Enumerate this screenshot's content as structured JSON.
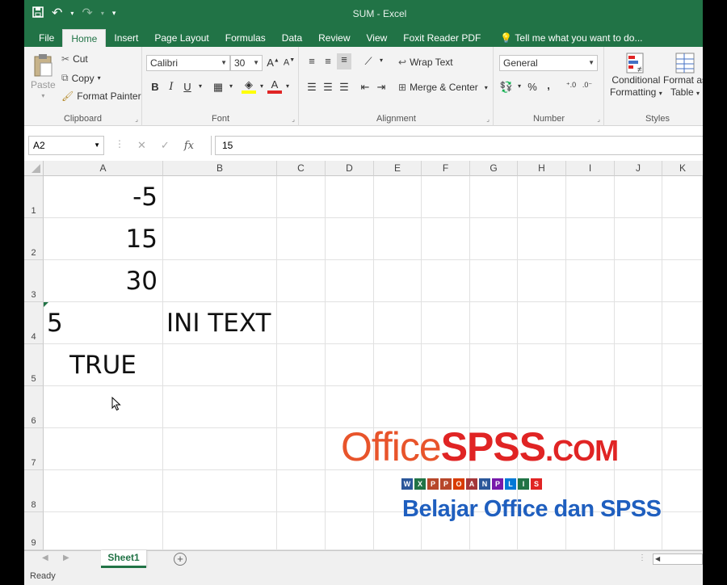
{
  "window": {
    "title": "SUM - Excel"
  },
  "qat": {
    "save_icon": "save-icon",
    "undo_icon": "undo-icon",
    "redo_icon": "redo-icon"
  },
  "tabs": [
    "File",
    "Home",
    "Insert",
    "Page Layout",
    "Formulas",
    "Data",
    "Review",
    "View",
    "Foxit Reader PDF"
  ],
  "active_tab": "Home",
  "tell_me": "Tell me what you want to do...",
  "ribbon": {
    "clipboard": {
      "paste": "Paste",
      "cut": "Cut",
      "copy": "Copy",
      "format_painter": "Format Painter",
      "label": "Clipboard"
    },
    "font": {
      "name": "Calibri",
      "size": "30",
      "bold": "B",
      "italic": "I",
      "underline": "U",
      "label": "Font"
    },
    "alignment": {
      "wrap_text": "Wrap Text",
      "merge_center": "Merge & Center",
      "label": "Alignment"
    },
    "number": {
      "format": "General",
      "percent": "%",
      "comma": ",",
      "label": "Number"
    },
    "styles": {
      "conditional_1": "Conditional",
      "conditional_2": "Formatting",
      "format_as_1": "Format as",
      "format_as_2": "Table",
      "label": "Styles"
    }
  },
  "formula_bar": {
    "name_box": "A2",
    "cancel": "✕",
    "enter": "✓",
    "fx": "fx",
    "value": "15"
  },
  "columns": [
    "A",
    "B",
    "C",
    "D",
    "E",
    "F",
    "G",
    "H",
    "I",
    "J",
    "K"
  ],
  "rows": [
    "1",
    "2",
    "3",
    "4",
    "5",
    "6",
    "7",
    "8",
    "9"
  ],
  "cells": {
    "A1": "-5",
    "A2": "15",
    "A3": "30",
    "A4": "5",
    "B4": "INI TEXT",
    "A5": "TRUE"
  },
  "watermark": {
    "office": "Office",
    "spss": "SPSS",
    "dotcom": ".COM",
    "tagline": "Belajar Office dan SPSS",
    "strip_letters": [
      "W",
      "X",
      "P",
      "P",
      "O",
      "A",
      "N",
      "P",
      "L",
      "I",
      "S"
    ],
    "colors": {
      "orange": "#e8542b",
      "red": "#e02424",
      "blue": "#1f5fbf"
    }
  },
  "sheets": [
    "Sheet1"
  ],
  "status": "Ready",
  "colors": {
    "excel_green": "#217346"
  }
}
